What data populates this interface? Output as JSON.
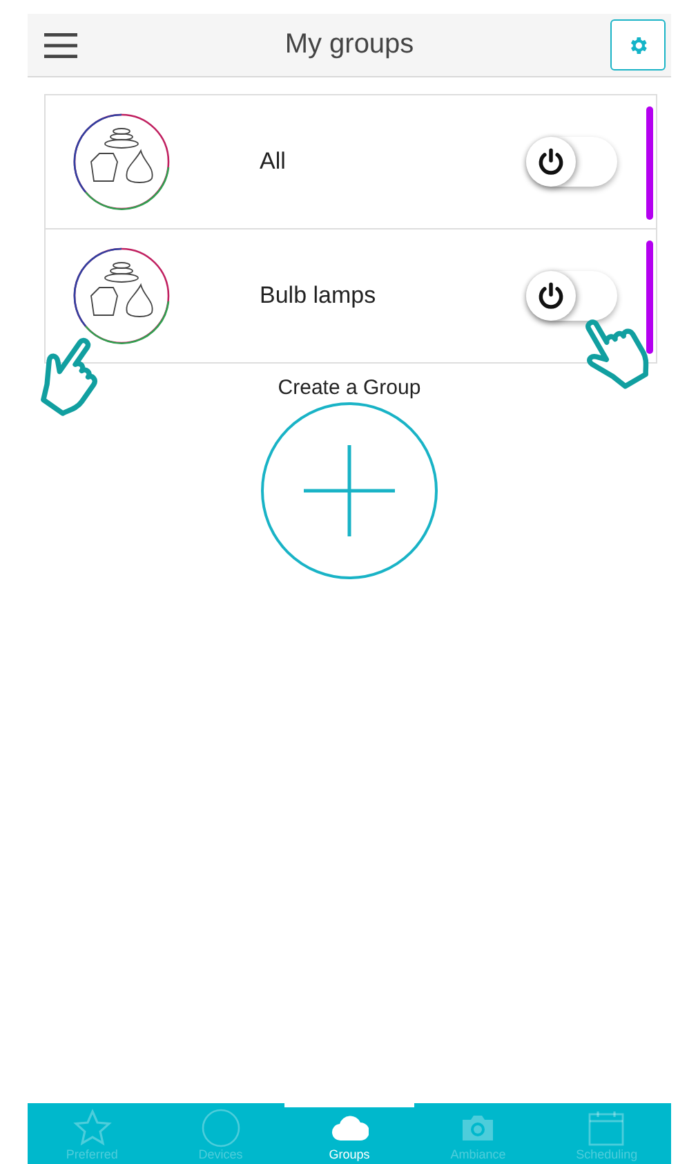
{
  "header": {
    "title": "My groups"
  },
  "groups": [
    {
      "name": "All",
      "on": false,
      "color": "#b400f0"
    },
    {
      "name": "Bulb lamps",
      "on": false,
      "color": "#b400f0"
    }
  ],
  "create": {
    "label": "Create a Group"
  },
  "tabs": [
    {
      "label": "Preferred",
      "kind": "star",
      "selected": false
    },
    {
      "label": "Devices",
      "kind": "circle",
      "selected": false
    },
    {
      "label": "Groups",
      "kind": "cloud",
      "selected": true
    },
    {
      "label": "Ambiance",
      "kind": "camera",
      "selected": false
    },
    {
      "label": "Scheduling",
      "kind": "calendar",
      "selected": false
    }
  ]
}
